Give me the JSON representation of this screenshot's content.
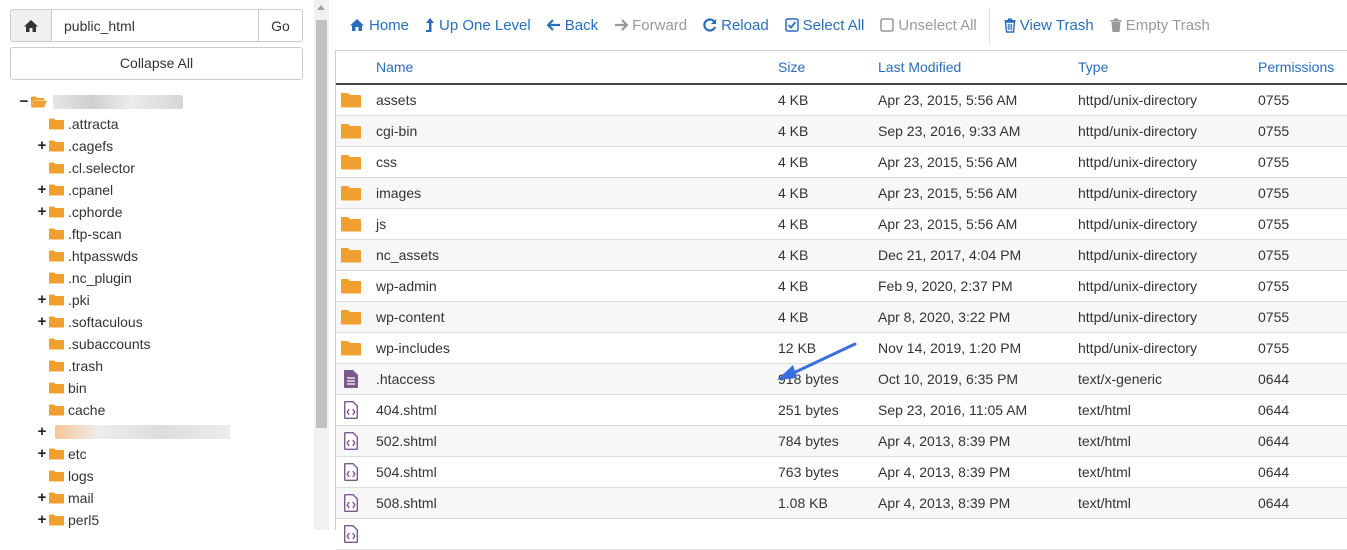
{
  "left": {
    "path_value": "public_html",
    "go_label": "Go",
    "collapse_label": "Collapse All",
    "tree": [
      {
        "label": "",
        "toggle": "",
        "blur": true,
        "blur_width": 130
      },
      {
        "label": ".attracta",
        "toggle": ""
      },
      {
        "label": ".cagefs",
        "toggle": "+"
      },
      {
        "label": ".cl.selector",
        "toggle": ""
      },
      {
        "label": ".cpanel",
        "toggle": "+"
      },
      {
        "label": ".cphorde",
        "toggle": "+"
      },
      {
        "label": ".ftp-scan",
        "toggle": ""
      },
      {
        "label": ".htpasswds",
        "toggle": ""
      },
      {
        "label": ".nc_plugin",
        "toggle": ""
      },
      {
        "label": ".pki",
        "toggle": "+"
      },
      {
        "label": ".softaculous",
        "toggle": "+"
      },
      {
        "label": ".subaccounts",
        "toggle": ""
      },
      {
        "label": ".trash",
        "toggle": ""
      },
      {
        "label": "bin",
        "toggle": ""
      },
      {
        "label": "cache",
        "toggle": ""
      },
      {
        "label": "",
        "toggle": "+",
        "blur": true,
        "blur_width": 175
      },
      {
        "label": "etc",
        "toggle": "+"
      },
      {
        "label": "logs",
        "toggle": ""
      },
      {
        "label": "mail",
        "toggle": "+"
      },
      {
        "label": "perl5",
        "toggle": "+"
      }
    ]
  },
  "toolbar": {
    "home": "Home",
    "up_one_level": "Up One Level",
    "back": "Back",
    "forward": "Forward",
    "reload": "Reload",
    "select_all": "Select All",
    "unselect_all": "Unselect All",
    "view_trash": "View Trash",
    "empty_trash": "Empty Trash"
  },
  "table": {
    "headers": {
      "name": "Name",
      "size": "Size",
      "modified": "Last Modified",
      "type": "Type",
      "permissions": "Permissions"
    },
    "rows": [
      {
        "icon": "folder-icon",
        "name": "assets",
        "size": "4 KB",
        "modified": "Apr 23, 2015, 5:56 AM",
        "type": "httpd/unix-directory",
        "perm": "0755"
      },
      {
        "icon": "folder-icon",
        "name": "cgi-bin",
        "size": "4 KB",
        "modified": "Sep 23, 2016, 9:33 AM",
        "type": "httpd/unix-directory",
        "perm": "0755"
      },
      {
        "icon": "folder-icon",
        "name": "css",
        "size": "4 KB",
        "modified": "Apr 23, 2015, 5:56 AM",
        "type": "httpd/unix-directory",
        "perm": "0755"
      },
      {
        "icon": "folder-icon",
        "name": "images",
        "size": "4 KB",
        "modified": "Apr 23, 2015, 5:56 AM",
        "type": "httpd/unix-directory",
        "perm": "0755"
      },
      {
        "icon": "folder-icon",
        "name": "js",
        "size": "4 KB",
        "modified": "Apr 23, 2015, 5:56 AM",
        "type": "httpd/unix-directory",
        "perm": "0755"
      },
      {
        "icon": "folder-icon",
        "name": "nc_assets",
        "size": "4 KB",
        "modified": "Dec 21, 2017, 4:04 PM",
        "type": "httpd/unix-directory",
        "perm": "0755"
      },
      {
        "icon": "folder-icon",
        "name": "wp-admin",
        "size": "4 KB",
        "modified": "Feb 9, 2020, 2:37 PM",
        "type": "httpd/unix-directory",
        "perm": "0755"
      },
      {
        "icon": "folder-icon",
        "name": "wp-content",
        "size": "4 KB",
        "modified": "Apr 8, 2020, 3:22 PM",
        "type": "httpd/unix-directory",
        "perm": "0755"
      },
      {
        "icon": "folder-icon",
        "name": "wp-includes",
        "size": "12 KB",
        "modified": "Nov 14, 2019, 1:20 PM",
        "type": "httpd/unix-directory",
        "perm": "0755"
      },
      {
        "icon": "text-file-icon",
        "name": ".htaccess",
        "size": "918 bytes",
        "modified": "Oct 10, 2019, 6:35 PM",
        "type": "text/x-generic",
        "perm": "0644"
      },
      {
        "icon": "html-file-icon",
        "name": "404.shtml",
        "size": "251 bytes",
        "modified": "Sep 23, 2016, 11:05 AM",
        "type": "text/html",
        "perm": "0644"
      },
      {
        "icon": "html-file-icon",
        "name": "502.shtml",
        "size": "784 bytes",
        "modified": "Apr 4, 2013, 8:39 PM",
        "type": "text/html",
        "perm": "0644"
      },
      {
        "icon": "html-file-icon",
        "name": "504.shtml",
        "size": "763 bytes",
        "modified": "Apr 4, 2013, 8:39 PM",
        "type": "text/html",
        "perm": "0644"
      },
      {
        "icon": "html-file-icon",
        "name": "508.shtml",
        "size": "1.08 KB",
        "modified": "Apr 4, 2013, 8:39 PM",
        "type": "text/html",
        "perm": "0644"
      },
      {
        "icon": "html-file-icon",
        "name": "",
        "size": "",
        "modified": "",
        "type": "",
        "perm": ""
      }
    ]
  },
  "colors": {
    "link": "#2a6ebb",
    "folder": "#f0a030",
    "file": "#7a5a8a",
    "arrow": "#3b6fe0"
  }
}
